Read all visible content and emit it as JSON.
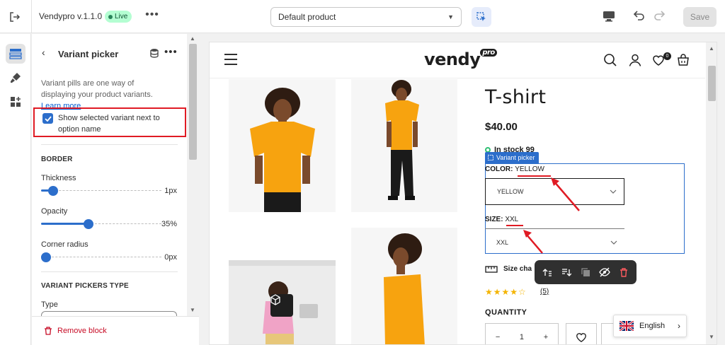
{
  "topbar": {
    "app_title": "Vendypro v.1.1.0",
    "status_label": "Live",
    "template_select": "Default product",
    "save_label": "Save"
  },
  "panel": {
    "title": "Variant picker",
    "description": "Variant pills are one way of displaying your product variants.",
    "learn_more": "Learn more",
    "checkbox_label": "Show selected variant next to option name",
    "border_section": "BORDER",
    "thickness_label": "Thickness",
    "thickness_value": "1px",
    "thickness_level": 0.06,
    "opacity_label": "Opacity",
    "opacity_value": "35%",
    "opacity_level": 0.35,
    "radius_label": "Corner radius",
    "radius_value": "0px",
    "radius_level": 0,
    "type_section": "VARIANT PICKERS TYPE",
    "type_label": "Type",
    "remove_label": "Remove block"
  },
  "store": {
    "logo_text": "vendy",
    "logo_badge": "pro",
    "cart_count": "0",
    "product_title": "T-shirt",
    "price": "$40.00",
    "stock": "In stock 99",
    "block_badge": "Variant picker",
    "color_label": "COLOR:",
    "color_value": "YELLOW",
    "color_select": "YELLOW",
    "size_label": "SIZE:",
    "size_value": "XXL",
    "size_select": "XXL",
    "size_chart": "Size cha",
    "rating_count": "(5)",
    "quantity_label": "QUANTITY",
    "qty_minus": "−",
    "qty_value": "1",
    "qty_plus": "+",
    "language": "English"
  },
  "colors": {
    "accent": "#2c6ecb",
    "highlight": "#e01b24",
    "live_badge": "#b4fed2",
    "shirt": "#f7a30f"
  }
}
